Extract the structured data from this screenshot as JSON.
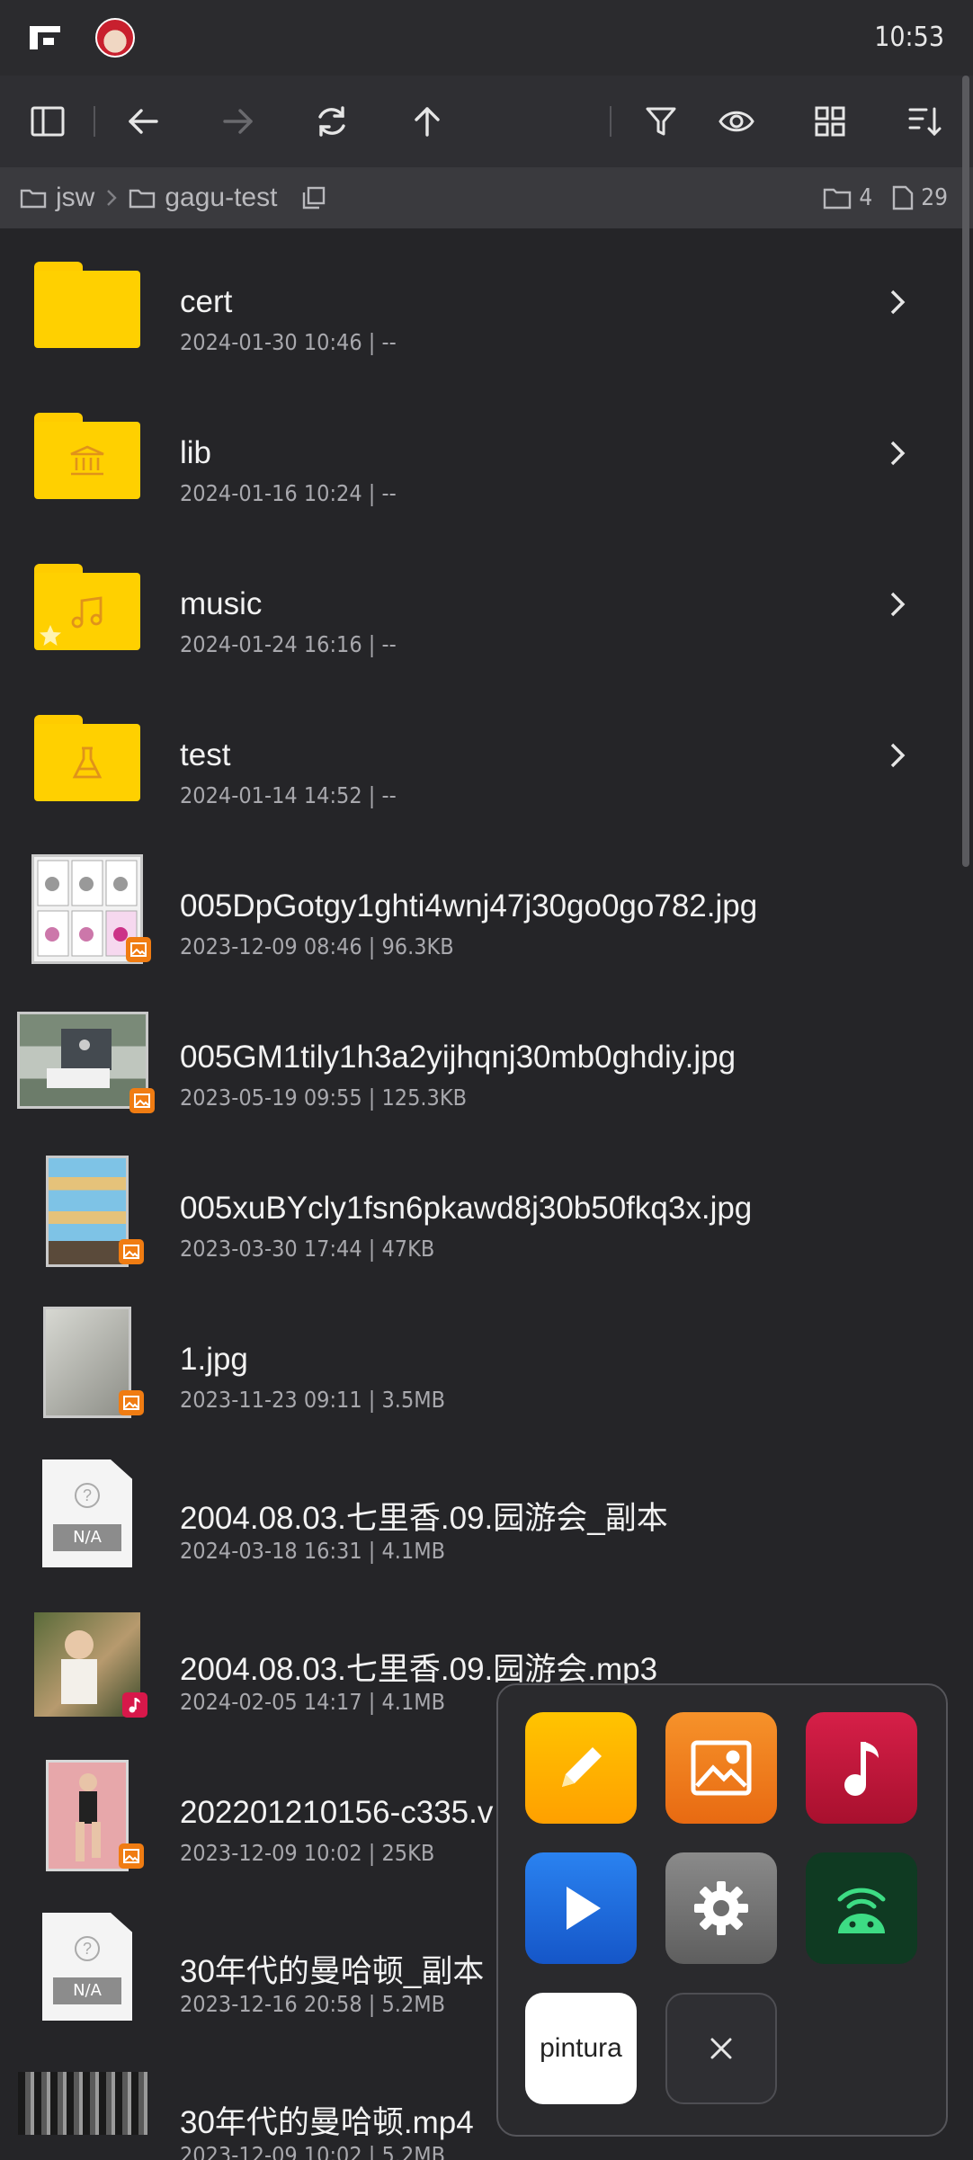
{
  "status_bar": {
    "time": "10:53"
  },
  "breadcrumb": {
    "items": [
      "jsw",
      "gagu-test"
    ],
    "folder_count": "4",
    "file_count": "29"
  },
  "files": [
    {
      "name": "cert",
      "meta": "2024-01-30 10:46  |  --",
      "kind": "folder",
      "icon": "plain-folder-icon"
    },
    {
      "name": "lib",
      "meta": "2024-01-16 10:24  |  --",
      "kind": "folder",
      "icon": "library-folder-icon"
    },
    {
      "name": "music",
      "meta": "2024-01-24 16:16  |  --",
      "kind": "folder",
      "icon": "music-folder-icon"
    },
    {
      "name": "test",
      "meta": "2024-01-14 14:52  |  --",
      "kind": "folder",
      "icon": "flask-folder-icon"
    },
    {
      "name": "005DpGotgy1ghti4wnj47j30go0go782.jpg",
      "meta": "2023-12-09 08:46  |  96.3KB",
      "kind": "image"
    },
    {
      "name": "005GM1tily1h3a2yijhqnj30mb0ghdiy.jpg",
      "meta": "2023-05-19 09:55  |  125.3KB",
      "kind": "image"
    },
    {
      "name": "005xuBYcly1fsn6pkawd8j30b50fkq3x.jpg",
      "meta": "2023-03-30 17:44  |  47KB",
      "kind": "image"
    },
    {
      "name": "1.jpg",
      "meta": "2023-11-23 09:11  |  3.5MB",
      "kind": "image"
    },
    {
      "name": "2004.08.03.七里香.09.园游会_副本",
      "meta": "2024-03-18 16:31  |  4.1MB",
      "kind": "unknown",
      "na_label": "N/A"
    },
    {
      "name": "2004.08.03.七里香.09.园游会.mp3",
      "meta": "2024-02-05 14:17  |  4.1MB",
      "kind": "audio"
    },
    {
      "name": "202201210156-c335.v",
      "meta": "2023-12-09 10:02  |  25KB",
      "kind": "image"
    },
    {
      "name": "30年代的曼哈顿_副本",
      "meta": "2023-12-16 20:58  |  5.2MB",
      "kind": "unknown",
      "na_label": "N/A"
    },
    {
      "name": "30年代的曼哈顿.mp4",
      "meta": "2023-12-09 10:02  |  5.2MB",
      "kind": "video"
    }
  ],
  "launcher": {
    "pintura_label": "pintura",
    "colors": {
      "editor": "#ffb400",
      "gallery": "#f07820",
      "music": "#c0143c",
      "player": "#1e6fe0",
      "settings": "#7a7a7a",
      "android": "#0f3a22"
    }
  },
  "colors": {
    "background": "#252528",
    "toolbar": "#2f2f33",
    "breadcrumb": "#3a3a3e",
    "folder": "#ffd000",
    "accent": "#f07c12"
  }
}
